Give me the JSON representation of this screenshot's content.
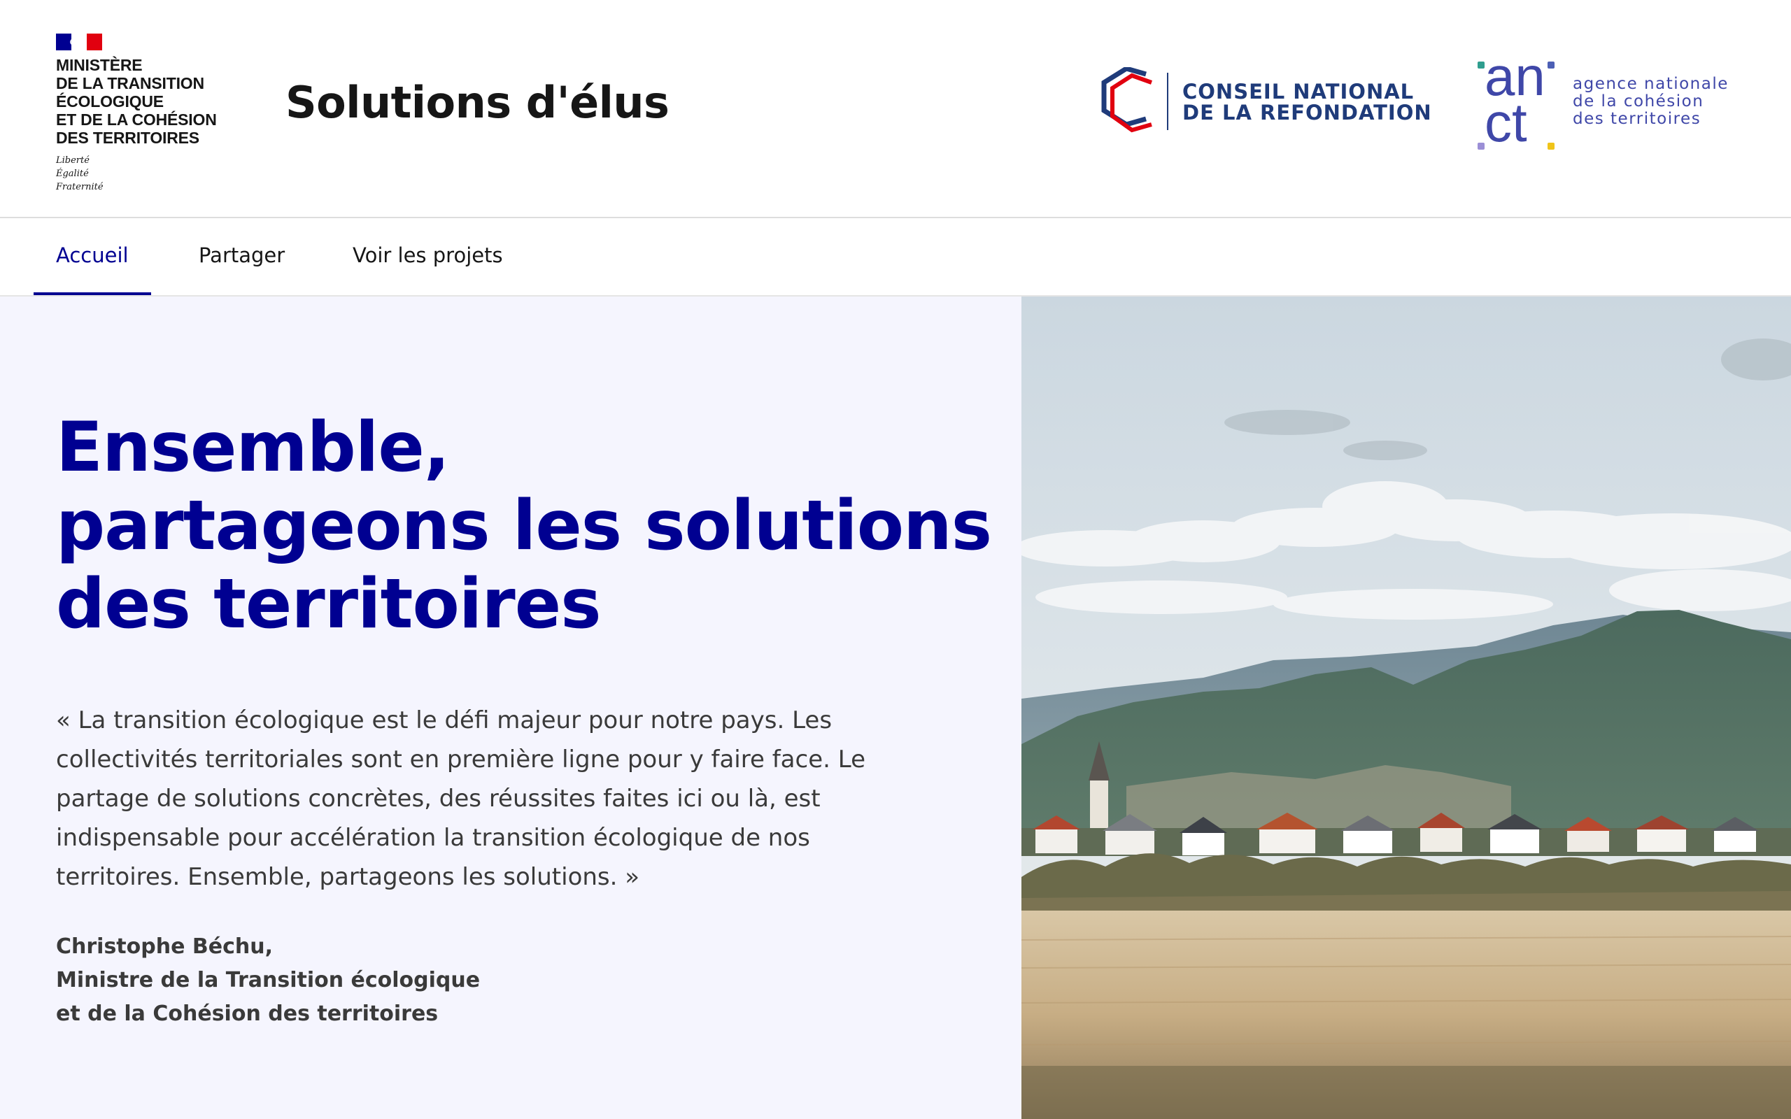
{
  "header": {
    "ministry_lines": [
      "MINISTÈRE",
      "DE LA TRANSITION",
      "ÉCOLOGIQUE",
      "ET DE LA COHÉSION",
      "DES TERRITOIRES"
    ],
    "devise_lines": [
      "Liberté",
      "Égalité",
      "Fraternité"
    ],
    "site_title": "Solutions d'élus",
    "partner_cnr": [
      "CONSEIL NATIONAL",
      "DE LA REFONDATION"
    ],
    "partner_anct_letters": [
      "an",
      "ct"
    ],
    "partner_anct_desc": [
      "agence nationale",
      "de la cohésion",
      "des territoires"
    ]
  },
  "nav": {
    "items": [
      {
        "label": "Accueil",
        "active": true
      },
      {
        "label": "Partager",
        "active": false
      },
      {
        "label": "Voir les projets",
        "active": false
      }
    ]
  },
  "hero": {
    "title_lines": [
      "Ensemble,",
      "partageons les solutions",
      "des territoires"
    ],
    "quote_lines": [
      "« La transition écologique est le défi majeur pour notre pays. Les",
      "collectivités territoriales sont en première ligne pour y faire face. Le",
      "partage de solutions concrètes, des réussites faites ici ou là, est",
      "indispensable pour accélération la transition écologique de nos",
      "territoires. Ensemble, partageons les solutions. »"
    ],
    "author_lines": [
      "Christophe Béchu,",
      "Ministre de la Transition écologique",
      "et de la Cohésion des territoires"
    ]
  },
  "colors": {
    "primary_blue": "#000091",
    "hero_background": "#f5f5fe",
    "text_dark": "#161616",
    "text_body": "#3a3a3a",
    "cnr_blue": "#1f3b7a",
    "anct_blue": "#3f47a8"
  }
}
